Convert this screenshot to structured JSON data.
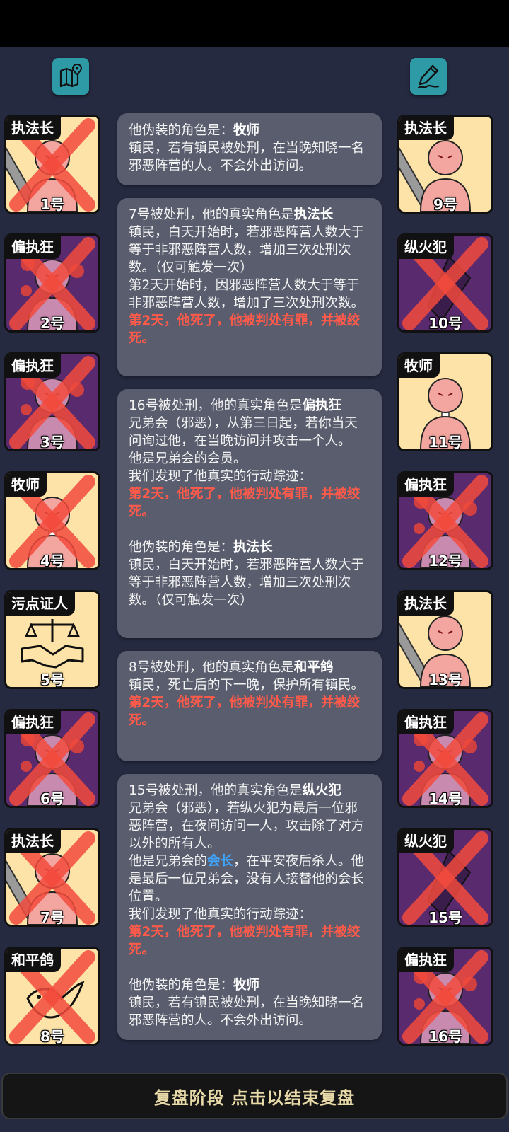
{
  "header": {
    "map_icon": "map-pin-icon",
    "notes_icon": "pen-note-icon"
  },
  "colors": {
    "background": "#262a40",
    "card_town": "#fde3a7",
    "card_evil": "#5a2a6e",
    "message_bg": "#595d6e",
    "death_text": "#ff5a4a",
    "link_text": "#3fa6ff",
    "button_text": "#e8d9a8"
  },
  "players_left": [
    {
      "role": "执法长",
      "number": "1号",
      "dead": true,
      "faction": "town"
    },
    {
      "role": "偏执狂",
      "number": "2号",
      "dead": true,
      "faction": "evil"
    },
    {
      "role": "偏执狂",
      "number": "3号",
      "dead": true,
      "faction": "evil"
    },
    {
      "role": "牧师",
      "number": "4号",
      "dead": true,
      "faction": "town"
    },
    {
      "role": "污点证人",
      "number": "5号",
      "dead": false,
      "faction": "town"
    },
    {
      "role": "偏执狂",
      "number": "6号",
      "dead": true,
      "faction": "evil"
    },
    {
      "role": "执法长",
      "number": "7号",
      "dead": true,
      "faction": "town"
    },
    {
      "role": "和平鸽",
      "number": "8号",
      "dead": true,
      "faction": "town"
    }
  ],
  "players_right": [
    {
      "role": "执法长",
      "number": "9号",
      "dead": false,
      "faction": "town"
    },
    {
      "role": "纵火犯",
      "number": "10号",
      "dead": true,
      "faction": "evil"
    },
    {
      "role": "牧师",
      "number": "11号",
      "dead": false,
      "faction": "town"
    },
    {
      "role": "偏执狂",
      "number": "12号",
      "dead": true,
      "faction": "evil"
    },
    {
      "role": "执法长",
      "number": "13号",
      "dead": false,
      "faction": "town"
    },
    {
      "role": "偏执狂",
      "number": "14号",
      "dead": true,
      "faction": "evil"
    },
    {
      "role": "纵火犯",
      "number": "15号",
      "dead": true,
      "faction": "evil"
    },
    {
      "role": "偏执狂",
      "number": "16号",
      "dead": true,
      "faction": "evil"
    }
  ],
  "log": {
    "m0": {
      "a": "他伪装的角色是：",
      "a_role": "牧师",
      "b": "镇民，若有镇民被处刑，在当晚知晓一名邪恶阵营的人。不会外出访问。"
    },
    "m1": {
      "a": "7号被处刑，他的真实角色是",
      "a_role": "执法长",
      "b": "镇民，白天开始时，若邪恶阵营人数大于等于非邪恶阵营人数，增加三次处刑次数。（仅可触发一次）",
      "c": "第2天开始时，因邪恶阵营人数大于等于非邪恶阵营人数，增加了三次处刑次数。",
      "death": "第2天，他死了，他被判处有罪，并被绞死。"
    },
    "m2": {
      "a": "16号被处刑，他的真实角色是",
      "a_role": "偏执狂",
      "b": "兄弟会（邪恶），从第三日起，若你当天问询过他，在当晚访问并攻击一个人。",
      "c": "他是兄弟会的会员。",
      "d": "我们发现了他真实的行动踪迹：",
      "death": "第2天，他死了，他被判处有罪，并被绞死。",
      "e": "他伪装的角色是：",
      "e_role": "执法长",
      "f": "镇民，白天开始时，若邪恶阵营人数大于等于非邪恶阵营人数，增加三次处刑次数。（仅可触发一次）"
    },
    "m3": {
      "a": "8号被处刑，他的真实角色是",
      "a_role": "和平鸽",
      "b": "镇民，死亡后的下一晚，保护所有镇民。",
      "death": "第2天，他死了，他被判处有罪，并被绞死。"
    },
    "m4": {
      "a": "15号被处刑，他的真实角色是",
      "a_role": "纵火犯",
      "b": "兄弟会（邪恶），若纵火犯为最后一位邪恶阵营，在夜间访问一人，攻击除了对方以外的所有人。",
      "c1": "他是兄弟会的",
      "c_link": "会长",
      "c2": "，在平安夜后杀人。他是最后一位兄弟会，没有人接替他的会长位置。",
      "d": "我们发现了他真实的行动踪迹：",
      "death": "第2天，他死了，他被判处有罪，并被绞死。",
      "e": "他伪装的角色是：",
      "e_role": "牧师",
      "f": "镇民，若有镇民被处刑，在当晚知晓一名邪恶阵营的人。不会外出访问。"
    }
  },
  "footer": {
    "label": "复盘阶段 点击以结束复盘"
  }
}
